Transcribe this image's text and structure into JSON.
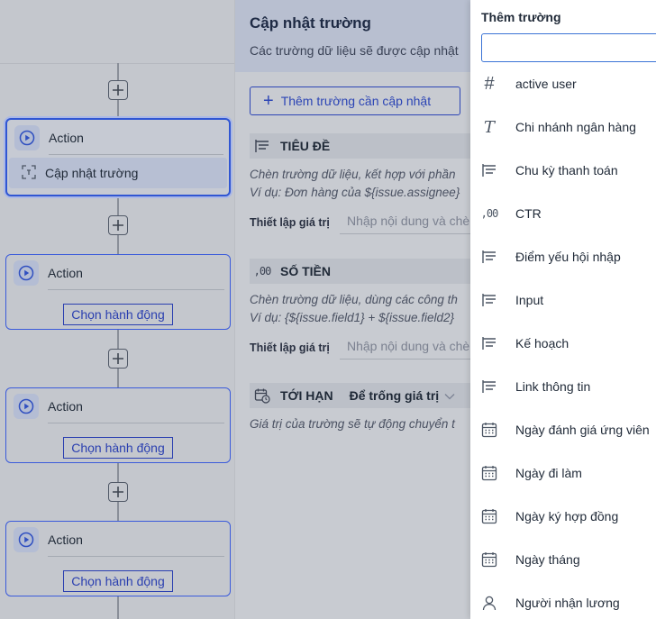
{
  "flow": {
    "nodes": [
      {
        "title": "Action",
        "action": "Cập nhật trường",
        "selected": true
      },
      {
        "title": "Action",
        "choose_label": "Chọn hành động"
      },
      {
        "title": "Action",
        "choose_label": "Chọn hành động"
      },
      {
        "title": "Action",
        "choose_label": "Chọn hành động"
      }
    ],
    "add_icon": "plus-icon"
  },
  "panel": {
    "title": "Cập nhật trường",
    "subtitle": "Các trường dữ liệu sẽ được cập nhật",
    "add_button": "Thêm trường cần cập nhật",
    "sections": [
      {
        "icon": "text-lines-icon",
        "name": "TIÊU ĐỀ",
        "help_line1": "Chèn trường dữ liệu, kết hợp với phần",
        "help_line2": "Ví dụ: Đơn hàng của ${issue.assignee}",
        "value_label": "Thiết lập giá trị",
        "value_placeholder": "Nhập nội dung và chè"
      },
      {
        "icon": "number-icon",
        "name": "SỐ TIỀN",
        "help_line1": "Chèn trường dữ liệu, dùng các công th",
        "help_line2": "Ví dụ: {${issue.field1} + ${issue.field2}",
        "value_label": "Thiết lập giá trị",
        "value_placeholder": "Nhập nội dung và chè"
      },
      {
        "icon": "calendar-clock-icon",
        "name": "TỚI HẠN",
        "select_value": "Để trống giá trị",
        "help_line1": "Giá trị của trường sẽ tự động chuyển t"
      }
    ]
  },
  "dropdown": {
    "title": "Thêm trường",
    "search_value": "",
    "items": [
      {
        "icon": "hash",
        "label": "active user"
      },
      {
        "icon": "T",
        "label": "Chi nhánh ngân hàng"
      },
      {
        "icon": "lines",
        "label": "Chu kỳ thanh toán"
      },
      {
        "icon": "num",
        "label": "CTR"
      },
      {
        "icon": "lines",
        "label": "Điểm yếu hội nhập"
      },
      {
        "icon": "lines",
        "label": "Input"
      },
      {
        "icon": "lines",
        "label": "Kế hoạch"
      },
      {
        "icon": "lines",
        "label": "Link thông tin"
      },
      {
        "icon": "calendar",
        "label": "Ngày đánh giá ứng viên"
      },
      {
        "icon": "calendar",
        "label": "Ngày đi làm"
      },
      {
        "icon": "calendar",
        "label": "Ngày ký hợp đồng"
      },
      {
        "icon": "calendar",
        "label": "Ngày tháng"
      },
      {
        "icon": "person",
        "label": "Người nhận lương"
      }
    ]
  },
  "colors": {
    "accent": "#2c45b5",
    "input_focus": "#3b74d6",
    "overlay": "#c4c7cd"
  }
}
